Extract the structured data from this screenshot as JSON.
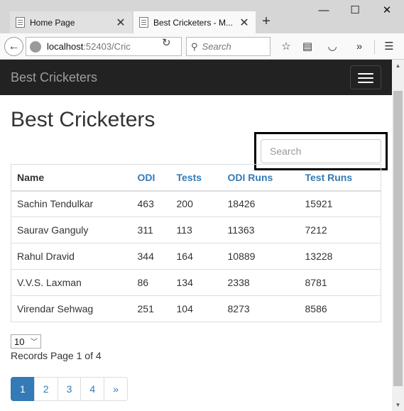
{
  "browser": {
    "tabs": [
      {
        "title": "Home Page",
        "close": "✕"
      },
      {
        "title": "Best Cricketers - M...",
        "close": "✕"
      }
    ],
    "new_tab": "+",
    "window_controls": {
      "minimize": "—",
      "maximize": "☐",
      "close": "✕"
    },
    "url_host": "localhost",
    "url_rest": ":52403/Cric",
    "search_placeholder": "Search",
    "icons": {
      "back": "arrow-left-icon",
      "identity": "globe-icon",
      "reload": "reload-icon",
      "search": "magnifier-icon",
      "bookmark": "star-icon",
      "reader": "reader-icon",
      "pocket": "pocket-icon",
      "overflow": "chevron-double-right-icon",
      "menu": "hamburger-menu-icon"
    }
  },
  "navbar": {
    "brand": "Best Cricketers",
    "background": "#222222"
  },
  "page": {
    "title": "Best Cricketers",
    "search_placeholder": "Search",
    "table": {
      "headers": [
        "Name",
        "ODI",
        "Tests",
        "ODI Runs",
        "Test Runs"
      ],
      "rows": [
        [
          "Sachin Tendulkar",
          "463",
          "200",
          "18426",
          "15921"
        ],
        [
          "Saurav Ganguly",
          "311",
          "113",
          "11363",
          "7212"
        ],
        [
          "Rahul Dravid",
          "344",
          "164",
          "10889",
          "13228"
        ],
        [
          "V.V.S. Laxman",
          "86",
          "134",
          "2338",
          "8781"
        ],
        [
          "Virendar Sehwag",
          "251",
          "104",
          "8273",
          "8586"
        ]
      ]
    },
    "page_size": "10",
    "records_info": "Records Page 1 of 4",
    "pagination": [
      "1",
      "2",
      "3",
      "4",
      "»"
    ],
    "active_page": "1",
    "link_color": "#337ab7"
  }
}
